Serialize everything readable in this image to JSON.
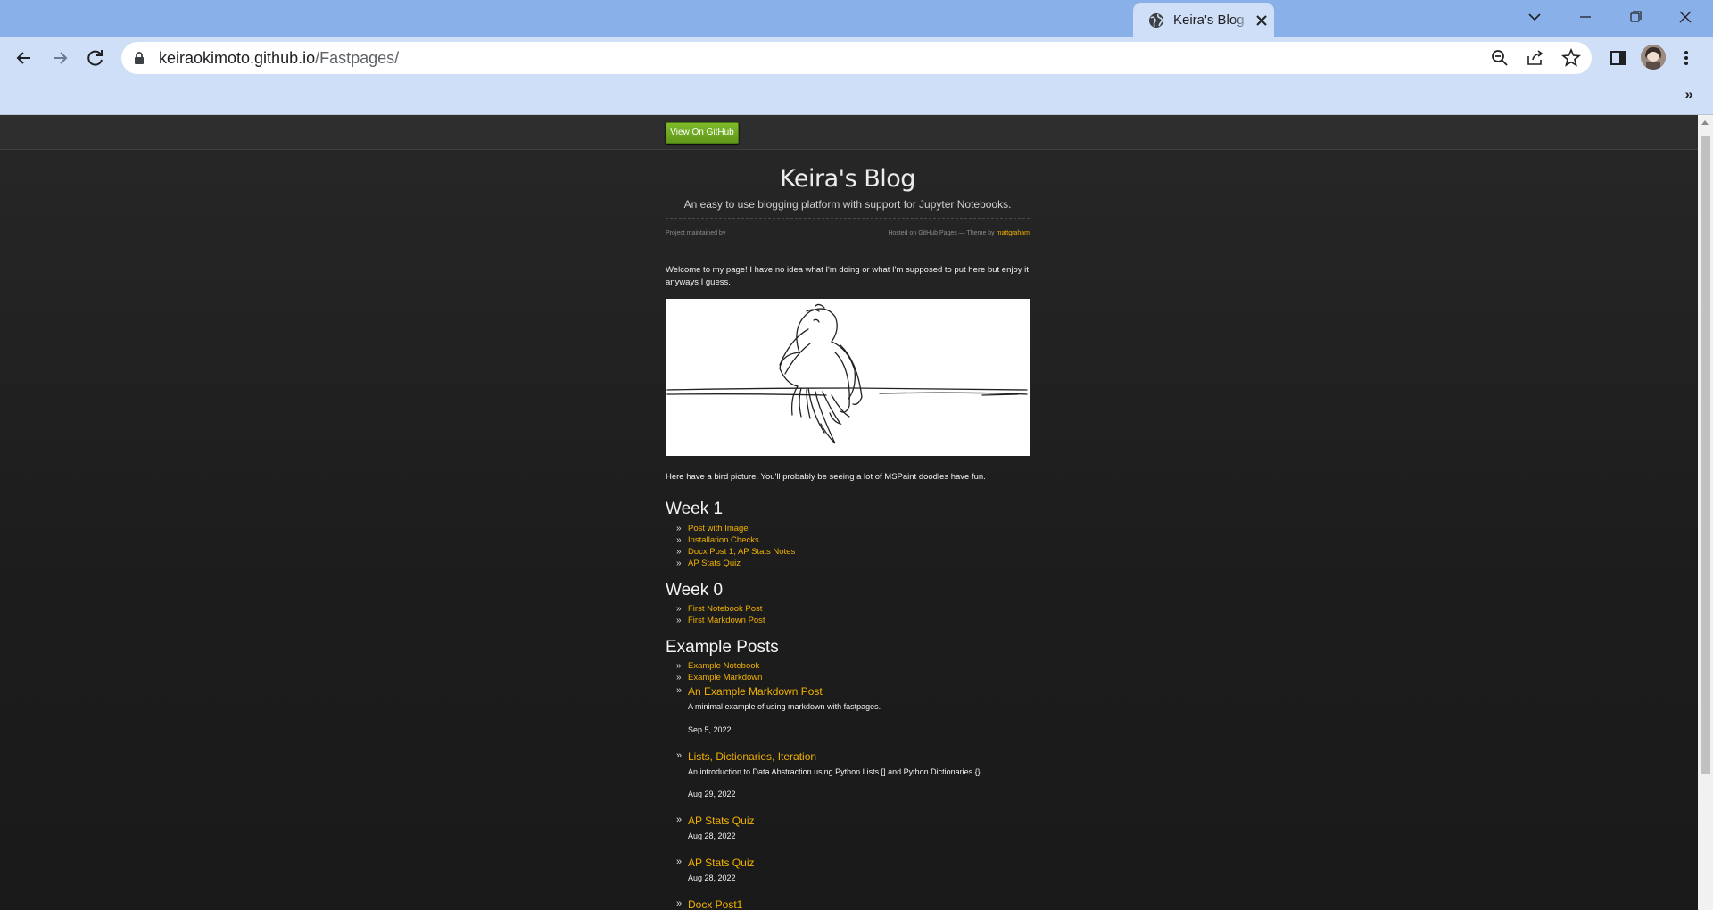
{
  "browser": {
    "tab_title": "Keira's Blog",
    "url_host": "keiraokimoto.github.io",
    "url_path": "/Fastpages/",
    "bookmarks_more": "»"
  },
  "page": {
    "github_button": "View On GitHub",
    "site_title": "Keira's Blog",
    "tagline": "An easy to use blogging platform with support for Jupyter Notebooks.",
    "maintained_by": "Project maintained by",
    "hosted_on": "Hosted on GitHub Pages — Theme by",
    "theme_author": "mattgraham",
    "intro": "Welcome to my page! I have no idea what I'm doing or what I'm supposed to put here but enjoy it anyways I guess.",
    "caption": "Here have a bird picture. You'll probably be seeing a lot of MSPaint doodles have fun.",
    "sections": [
      {
        "heading": "Week 1",
        "links": [
          "Post with Image",
          "Installation Checks",
          "Docx Post 1, AP Stats Notes",
          "AP Stats Quiz"
        ]
      },
      {
        "heading": "Week 0",
        "links": [
          "First Notebook Post",
          "First Markdown Post"
        ]
      },
      {
        "heading": "Example Posts",
        "links": [
          "Example Notebook",
          "Example Markdown"
        ]
      }
    ],
    "posts": [
      {
        "title": "An Example Markdown Post",
        "description": "A minimal example of using markdown with fastpages.",
        "date": "Sep 5, 2022"
      },
      {
        "title": "Lists, Dictionaries, Iteration",
        "description": "An introduction to Data Abstraction using Python Lists [] and Python Dictionaries {}.",
        "date": "Aug 29, 2022"
      },
      {
        "title": "AP Stats Quiz",
        "description": "",
        "date": "Aug 28, 2022"
      },
      {
        "title": "AP Stats Quiz",
        "description": "",
        "date": "Aug 28, 2022"
      },
      {
        "title": "Docx Post1",
        "description": "",
        "date": ""
      }
    ]
  },
  "icons": {
    "tab": "globe-icon",
    "address": "lock-icon",
    "omnibox": [
      "zoom-out-icon",
      "share-icon",
      "star-icon"
    ],
    "toolbar_right": [
      "side-panel-icon",
      "profile-avatar",
      "kebab-menu-icon"
    ]
  },
  "colors": {
    "tabstrip": "#8ab0ea",
    "toolbar": "#cfdff7",
    "page_bg": "#1f1f1f",
    "link": "#f0b100",
    "github_button": "#6da922"
  }
}
